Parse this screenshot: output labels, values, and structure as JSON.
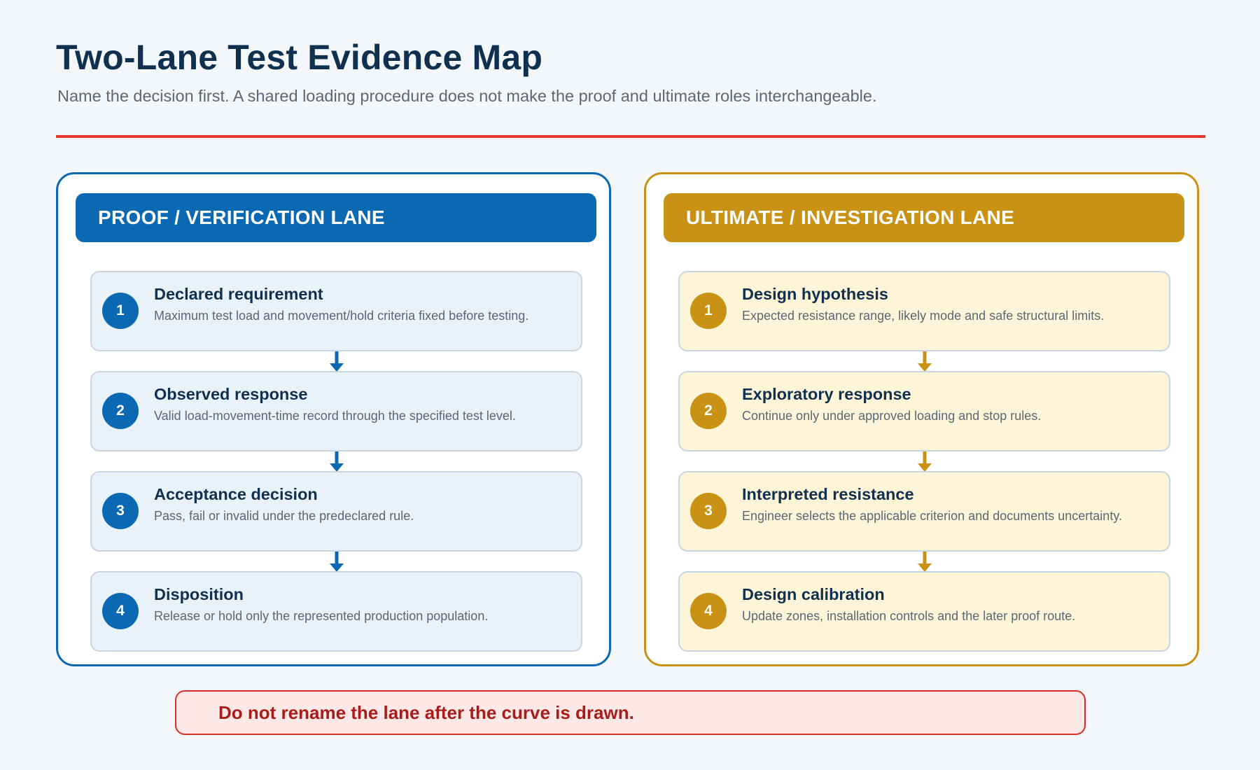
{
  "title": "Two-Lane Test Evidence Map",
  "subtitle": "Name the decision first. A shared loading procedure does not make the proof and ultimate roles interchangeable.",
  "colors": {
    "accent_rule": "#e8362f",
    "proof_primary": "#0b68b3",
    "proof_step_bg": "#e9f1f9",
    "ultimate_primary": "#c99214",
    "ultimate_step_bg": "#fef4d8",
    "warning_bg": "#fde8e8",
    "warning_border": "#d92d27",
    "warning_text": "#a61d1a"
  },
  "lanes": [
    {
      "header": "PROOF / VERIFICATION LANE",
      "steps": [
        {
          "number": "1",
          "title": "Declared requirement",
          "description": "Maximum test load and movement/hold criteria fixed before testing."
        },
        {
          "number": "2",
          "title": "Observed response",
          "description": "Valid load-movement-time record through the specified test level."
        },
        {
          "number": "3",
          "title": "Acceptance decision",
          "description": "Pass, fail or invalid under the predeclared rule."
        },
        {
          "number": "4",
          "title": "Disposition",
          "description": "Release or hold only the represented production population."
        }
      ]
    },
    {
      "header": "ULTIMATE / INVESTIGATION LANE",
      "steps": [
        {
          "number": "1",
          "title": "Design hypothesis",
          "description": "Expected resistance range, likely mode and safe structural limits."
        },
        {
          "number": "2",
          "title": "Exploratory response",
          "description": "Continue only under approved loading and stop rules."
        },
        {
          "number": "3",
          "title": "Interpreted resistance",
          "description": "Engineer selects the applicable criterion and documents uncertainty."
        },
        {
          "number": "4",
          "title": "Design calibration",
          "description": "Update zones, installation controls and the later proof route."
        }
      ]
    }
  ],
  "warning": "Do not rename the lane after the curve is drawn."
}
